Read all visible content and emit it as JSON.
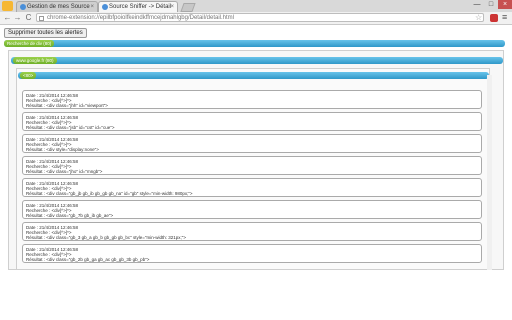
{
  "browser": {
    "tabs": [
      {
        "title": "Gestion de mes Source"
      },
      {
        "title": "Source Sniffer -> Détail"
      }
    ],
    "close_symbol": "×",
    "url": "chrome-extension://epilbfpoiolfkeindkffmcejdmahlgbg/Detail/detail.html",
    "window_controls": [
      "—",
      "□",
      "×"
    ],
    "nav_symbols": {
      "back": "←",
      "forward": "→",
      "reload": "C"
    },
    "star_symbol": "☆",
    "menu_symbol": "≡"
  },
  "page": {
    "delete_button": "Supprimer toutes les alertes",
    "search_badge": "Recherche de div (80)",
    "site_badge": "www.google.fr (80)",
    "tag_badge": "<80>",
    "entries": [
      {
        "date": "Date : 21/4/2014 12:46:58",
        "recherche": "Recherche : <div[^>]*>",
        "resultat": "Résultat : <div class=\"jhh\" id=\"viewport\">"
      },
      {
        "date": "Date : 21/4/2014 12:46:58",
        "recherche": "Recherche : <div[^>]*>",
        "resultat": "Résultat : <div class=\"jsb\" id=\"cst\" id=\"cue\">"
      },
      {
        "date": "Date : 21/4/2014 12:46:58",
        "recherche": "Recherche : <div[^>]*>",
        "resultat": "Résultat : <div style=\"display:none\">"
      },
      {
        "date": "Date : 21/4/2014 12:46:58",
        "recherche": "Recherche : <div[^>]*>",
        "resultat": "Résultat : <div class=\"jho\" id=\"mngb\">"
      },
      {
        "date": "Date : 21/4/2014 12:46:58",
        "recherche": "Recherche : <div[^>]*>",
        "resultat": "Résultat : <div class=\"gb_jb gb_ib gb_gb gb_na\" id=\"gb\" style=\"min-width: 980px;\">"
      },
      {
        "date": "Date : 21/4/2014 12:46:58",
        "recherche": "Recherche : <div[^>]*>",
        "resultat": "Résultat : <div class=\"gb_7b gb_ib gb_ae\">"
      },
      {
        "date": "Date : 21/4/2014 12:46:58",
        "recherche": "Recherche : <div[^>]*>",
        "resultat": "Résultat : <div class=\"gb_3 gb_a gb_b gb_gb gb_bc\" style=\"min-width: 321px;\">"
      },
      {
        "date": "Date : 21/4/2014 12:46:58",
        "recherche": "Recherche : <div[^>]*>",
        "resultat": "Résultat : <div class=\"gb_2b gb_ga gb_ac gb_gb_3b gb_pb\">"
      }
    ]
  }
}
